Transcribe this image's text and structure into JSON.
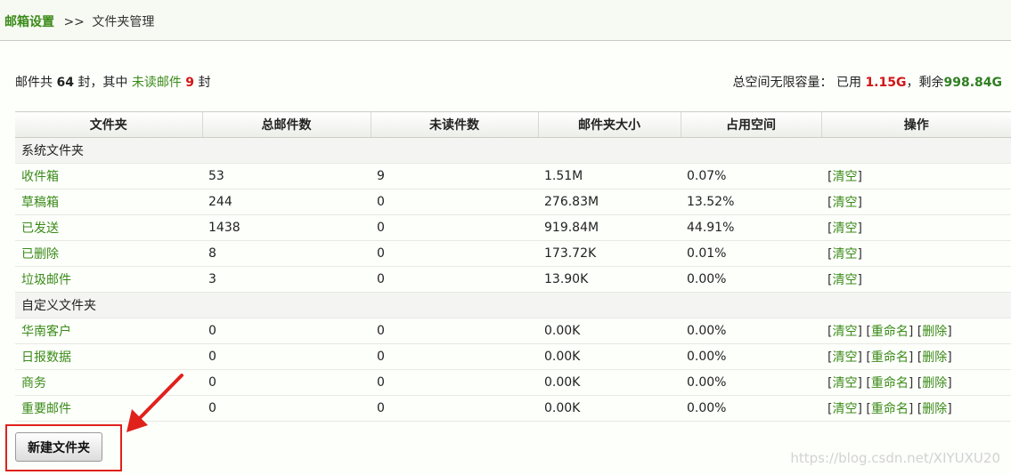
{
  "breadcrumb": {
    "root": "邮箱设置",
    "separator": ">>",
    "current": "文件夹管理"
  },
  "summary": {
    "prefix": "邮件共",
    "total": "64",
    "mid": "封，其中",
    "unread_label": "未读邮件",
    "unread": "9",
    "suffix": "封",
    "capacity_label": "总空间无限容量：",
    "used_label": "已用",
    "used": "1.15G",
    "remain_label": "，剩余",
    "remain": "998.84G"
  },
  "table": {
    "headers": [
      "文件夹",
      "总邮件数",
      "未读件数",
      "邮件夹大小",
      "占用空间",
      "操作"
    ],
    "groups": [
      {
        "label": "系统文件夹",
        "rows": [
          {
            "name": "收件箱",
            "total": "53",
            "unread": "9",
            "size": "1.51M",
            "usage": "0.07%"
          },
          {
            "name": "草稿箱",
            "total": "244",
            "unread": "0",
            "size": "276.83M",
            "usage": "13.52%"
          },
          {
            "name": "已发送",
            "total": "1438",
            "unread": "0",
            "size": "919.84M",
            "usage": "44.91%"
          },
          {
            "name": "已删除",
            "total": "8",
            "unread": "0",
            "size": "173.72K",
            "usage": "0.01%"
          },
          {
            "name": "垃圾邮件",
            "total": "3",
            "unread": "0",
            "size": "13.90K",
            "usage": "0.00%"
          }
        ]
      },
      {
        "label": "自定义文件夹",
        "rows": [
          {
            "name": "华南客户",
            "total": "0",
            "unread": "0",
            "size": "0.00K",
            "usage": "0.00%"
          },
          {
            "name": "日报数据",
            "total": "0",
            "unread": "0",
            "size": "0.00K",
            "usage": "0.00%"
          },
          {
            "name": "商务",
            "total": "0",
            "unread": "0",
            "size": "0.00K",
            "usage": "0.00%"
          },
          {
            "name": "重要邮件",
            "total": "0",
            "unread": "0",
            "size": "0.00K",
            "usage": "0.00%"
          }
        ]
      }
    ],
    "actions": {
      "clear": "清空",
      "rename": "重命名",
      "delete": "删除"
    }
  },
  "new_folder_button": "新建文件夹",
  "watermark": "https://blog.csdn.net/XIYUXU20",
  "colors": {
    "link_green": "#3a8a18",
    "highlight_red": "#e0211c",
    "used_red": "#d21616",
    "remain_green": "#2f7f22"
  }
}
